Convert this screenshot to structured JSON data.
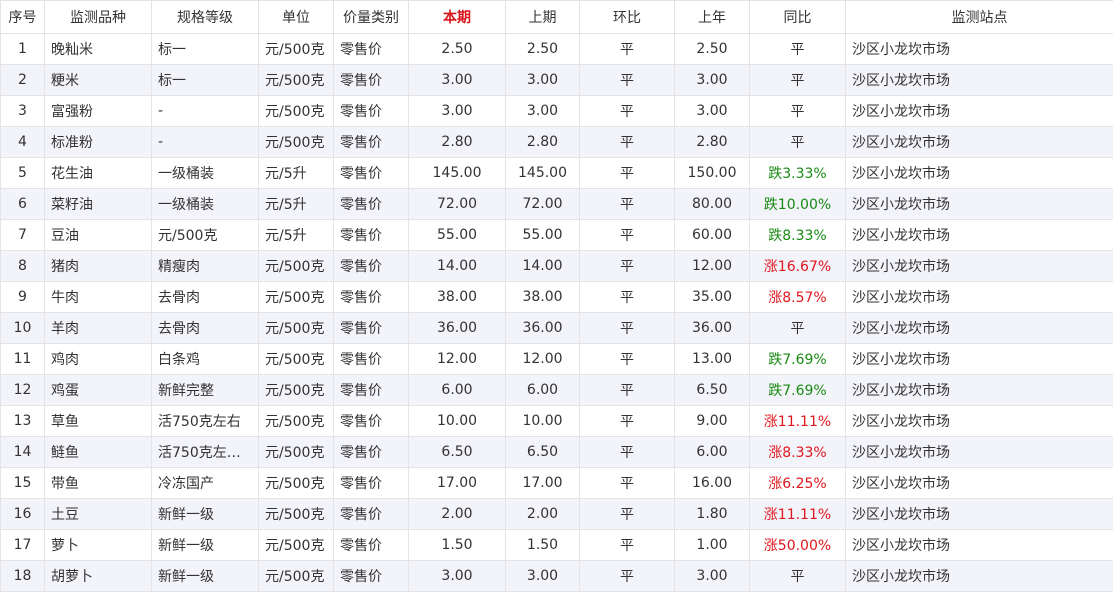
{
  "headers": [
    "序号",
    "监测品种",
    "规格等级",
    "单位",
    "价量类别",
    "本期",
    "上期",
    "环比",
    "上年",
    "同比",
    "监测站点"
  ],
  "colors": {
    "current_header": "#d9141b",
    "rise": "#e0161c",
    "fall": "#188a12",
    "stripe": "#f3f3fa"
  },
  "rows": [
    {
      "no": "1",
      "item": "晚籼米",
      "spec": "标一",
      "unit": "元/500克",
      "type": "零售价",
      "current": "2.50",
      "prev": "2.50",
      "mom": "平",
      "last_year": "2.50",
      "yoy": "平",
      "yoy_dir": "flat",
      "site": "沙区小龙坎市场"
    },
    {
      "no": "2",
      "item": "粳米",
      "spec": "标一",
      "unit": "元/500克",
      "type": "零售价",
      "current": "3.00",
      "prev": "3.00",
      "mom": "平",
      "last_year": "3.00",
      "yoy": "平",
      "yoy_dir": "flat",
      "site": "沙区小龙坎市场"
    },
    {
      "no": "3",
      "item": "富强粉",
      "spec": "-",
      "unit": "元/500克",
      "type": "零售价",
      "current": "3.00",
      "prev": "3.00",
      "mom": "平",
      "last_year": "3.00",
      "yoy": "平",
      "yoy_dir": "flat",
      "site": "沙区小龙坎市场"
    },
    {
      "no": "4",
      "item": "标准粉",
      "spec": "-",
      "unit": "元/500克",
      "type": "零售价",
      "current": "2.80",
      "prev": "2.80",
      "mom": "平",
      "last_year": "2.80",
      "yoy": "平",
      "yoy_dir": "flat",
      "site": "沙区小龙坎市场"
    },
    {
      "no": "5",
      "item": "花生油",
      "spec": "一级桶装",
      "unit": "元/5升",
      "type": "零售价",
      "current": "145.00",
      "prev": "145.00",
      "mom": "平",
      "last_year": "150.00",
      "yoy": "跌3.33%",
      "yoy_dir": "down",
      "site": "沙区小龙坎市场"
    },
    {
      "no": "6",
      "item": "菜籽油",
      "spec": "一级桶装",
      "unit": "元/5升",
      "type": "零售价",
      "current": "72.00",
      "prev": "72.00",
      "mom": "平",
      "last_year": "80.00",
      "yoy": "跌10.00%",
      "yoy_dir": "down",
      "site": "沙区小龙坎市场"
    },
    {
      "no": "7",
      "item": "豆油",
      "spec": "元/500克",
      "unit": "元/5升",
      "type": "零售价",
      "current": "55.00",
      "prev": "55.00",
      "mom": "平",
      "last_year": "60.00",
      "yoy": "跌8.33%",
      "yoy_dir": "down",
      "site": "沙区小龙坎市场"
    },
    {
      "no": "8",
      "item": "猪肉",
      "spec": "精瘦肉",
      "unit": "元/500克",
      "type": "零售价",
      "current": "14.00",
      "prev": "14.00",
      "mom": "平",
      "last_year": "12.00",
      "yoy": "涨16.67%",
      "yoy_dir": "up",
      "site": "沙区小龙坎市场"
    },
    {
      "no": "9",
      "item": "牛肉",
      "spec": "去骨肉",
      "unit": "元/500克",
      "type": "零售价",
      "current": "38.00",
      "prev": "38.00",
      "mom": "平",
      "last_year": "35.00",
      "yoy": "涨8.57%",
      "yoy_dir": "up",
      "site": "沙区小龙坎市场"
    },
    {
      "no": "10",
      "item": "羊肉",
      "spec": "去骨肉",
      "unit": "元/500克",
      "type": "零售价",
      "current": "36.00",
      "prev": "36.00",
      "mom": "平",
      "last_year": "36.00",
      "yoy": "平",
      "yoy_dir": "flat",
      "site": "沙区小龙坎市场"
    },
    {
      "no": "11",
      "item": "鸡肉",
      "spec": "白条鸡",
      "unit": "元/500克",
      "type": "零售价",
      "current": "12.00",
      "prev": "12.00",
      "mom": "平",
      "last_year": "13.00",
      "yoy": "跌7.69%",
      "yoy_dir": "down",
      "site": "沙区小龙坎市场"
    },
    {
      "no": "12",
      "item": "鸡蛋",
      "spec": "新鲜完整",
      "unit": "元/500克",
      "type": "零售价",
      "current": "6.00",
      "prev": "6.00",
      "mom": "平",
      "last_year": "6.50",
      "yoy": "跌7.69%",
      "yoy_dir": "down",
      "site": "沙区小龙坎市场"
    },
    {
      "no": "13",
      "item": "草鱼",
      "spec": "活750克左右",
      "unit": "元/500克",
      "type": "零售价",
      "current": "10.00",
      "prev": "10.00",
      "mom": "平",
      "last_year": "9.00",
      "yoy": "涨11.11%",
      "yoy_dir": "up",
      "site": "沙区小龙坎市场"
    },
    {
      "no": "14",
      "item": "鲢鱼",
      "spec": "活750克左右...",
      "unit": "元/500克",
      "type": "零售价",
      "current": "6.50",
      "prev": "6.50",
      "mom": "平",
      "last_year": "6.00",
      "yoy": "涨8.33%",
      "yoy_dir": "up",
      "site": "沙区小龙坎市场"
    },
    {
      "no": "15",
      "item": "带鱼",
      "spec": "冷冻国产",
      "unit": "元/500克",
      "type": "零售价",
      "current": "17.00",
      "prev": "17.00",
      "mom": "平",
      "last_year": "16.00",
      "yoy": "涨6.25%",
      "yoy_dir": "up",
      "site": "沙区小龙坎市场"
    },
    {
      "no": "16",
      "item": "土豆",
      "spec": "新鲜一级",
      "unit": "元/500克",
      "type": "零售价",
      "current": "2.00",
      "prev": "2.00",
      "mom": "平",
      "last_year": "1.80",
      "yoy": "涨11.11%",
      "yoy_dir": "up",
      "site": "沙区小龙坎市场"
    },
    {
      "no": "17",
      "item": "萝卜",
      "spec": "新鲜一级",
      "unit": "元/500克",
      "type": "零售价",
      "current": "1.50",
      "prev": "1.50",
      "mom": "平",
      "last_year": "1.00",
      "yoy": "涨50.00%",
      "yoy_dir": "up",
      "site": "沙区小龙坎市场"
    },
    {
      "no": "18",
      "item": "胡萝卜",
      "spec": "新鲜一级",
      "unit": "元/500克",
      "type": "零售价",
      "current": "3.00",
      "prev": "3.00",
      "mom": "平",
      "last_year": "3.00",
      "yoy": "平",
      "yoy_dir": "flat",
      "site": "沙区小龙坎市场"
    }
  ]
}
